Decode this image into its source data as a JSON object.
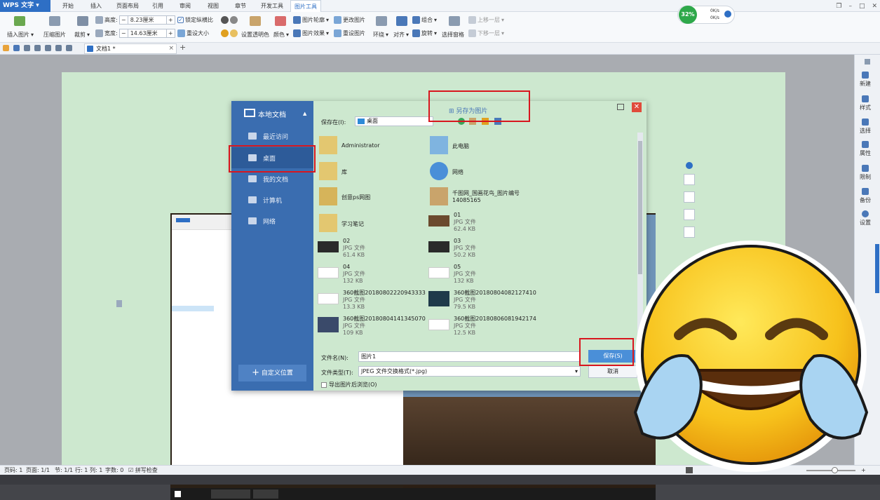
{
  "app": {
    "brand": "WPS 文字",
    "dropdown": "▾"
  },
  "tabs": [
    "开始",
    "插入",
    "页面布局",
    "引用",
    "审阅",
    "视图",
    "章节",
    "开发工具",
    "图片工具"
  ],
  "ribbon": {
    "insert_picture": "插入图片",
    "compress_picture": "压缩图片",
    "crop": "裁剪",
    "height_label": "高度:",
    "height_value": "8.23厘米",
    "width_label": "宽度:",
    "width_value": "14.63厘米",
    "lock_ratio": "锁定纵横比",
    "reset_size": "重设大小",
    "set_transparent": "设置透明色",
    "color": "颜色",
    "picture_outline": "图片轮廓",
    "picture_effect": "图片效果",
    "change_picture": "更改图片",
    "reset_picture": "重设图片",
    "wrap": "环绕",
    "align": "对齐",
    "group": "组合",
    "rotate": "旋转",
    "selection_pane": "选择窗格",
    "bring_forward": "上移一层",
    "send_backward": "下移一层"
  },
  "net_widget": {
    "percent": "32%",
    "up": "0K/s",
    "down": "0K/s"
  },
  "doc_tab": {
    "name": "文档1 *",
    "close": "×",
    "new": "+"
  },
  "right_panel": [
    "新建",
    "样式",
    "选择",
    "属性",
    "限制",
    "备份",
    "设置"
  ],
  "dialog": {
    "nav_title": "本地文档",
    "nav_items": [
      "最近访问",
      "桌面",
      "我的文档",
      "计算机",
      "网络"
    ],
    "custom_location": "自定义位置",
    "title": "另存为图片",
    "save_in_label": "保存在(I):",
    "save_in_value": "桌面",
    "files": [
      {
        "name": "Administrator",
        "type": "",
        "size": ""
      },
      {
        "name": "此电脑",
        "type": "",
        "size": ""
      },
      {
        "name": "库",
        "type": "",
        "size": ""
      },
      {
        "name": "网络",
        "type": "",
        "size": ""
      },
      {
        "name": "创意ps网图",
        "type": "",
        "size": ""
      },
      {
        "name": "千图网_国画花鸟_图片编号14085165",
        "type": "",
        "size": ""
      },
      {
        "name": "学习笔记",
        "type": "",
        "size": ""
      },
      {
        "name": "01",
        "type": "JPG 文件",
        "size": "62.4 KB"
      },
      {
        "name": "02",
        "type": "JPG 文件",
        "size": "61.4 KB"
      },
      {
        "name": "03",
        "type": "JPG 文件",
        "size": "50.2 KB"
      },
      {
        "name": "04",
        "type": "JPG 文件",
        "size": "132 KB"
      },
      {
        "name": "05",
        "type": "JPG 文件",
        "size": "132 KB"
      },
      {
        "name": "360截图20180802220943333",
        "type": "JPG 文件",
        "size": "13.3 KB"
      },
      {
        "name": "360截图20180804082127410",
        "type": "JPG 文件",
        "size": "79.5 KB"
      },
      {
        "name": "360截图20180804141345070",
        "type": "JPG 文件",
        "size": "109 KB"
      },
      {
        "name": "360截图20180806081942174",
        "type": "JPG 文件",
        "size": "12.5 KB"
      }
    ],
    "filename_label": "文件名(N):",
    "filename_value": "图片1",
    "filetype_label": "文件类型(T):",
    "filetype_value": "JPEG 文件交换格式(*.jpg)",
    "save_button": "保存(S)",
    "cancel_button": "取消",
    "preview_checkbox": "导出图片后浏览(O)"
  },
  "status": {
    "page": "页码: 1",
    "pages": "页面: 1/1",
    "section": "节: 1/1",
    "row": "行: 1",
    "col": "列: 1",
    "words": "字数: 0",
    "spell": "拼写检查"
  },
  "colors": {
    "accent": "#2e6fc5",
    "dialog_nav": "#3a6db0",
    "page_bg": "#cde8cf",
    "highlight": "#d8161e"
  },
  "emoji": {
    "name": "face-with-tears-of-joy-icon"
  }
}
